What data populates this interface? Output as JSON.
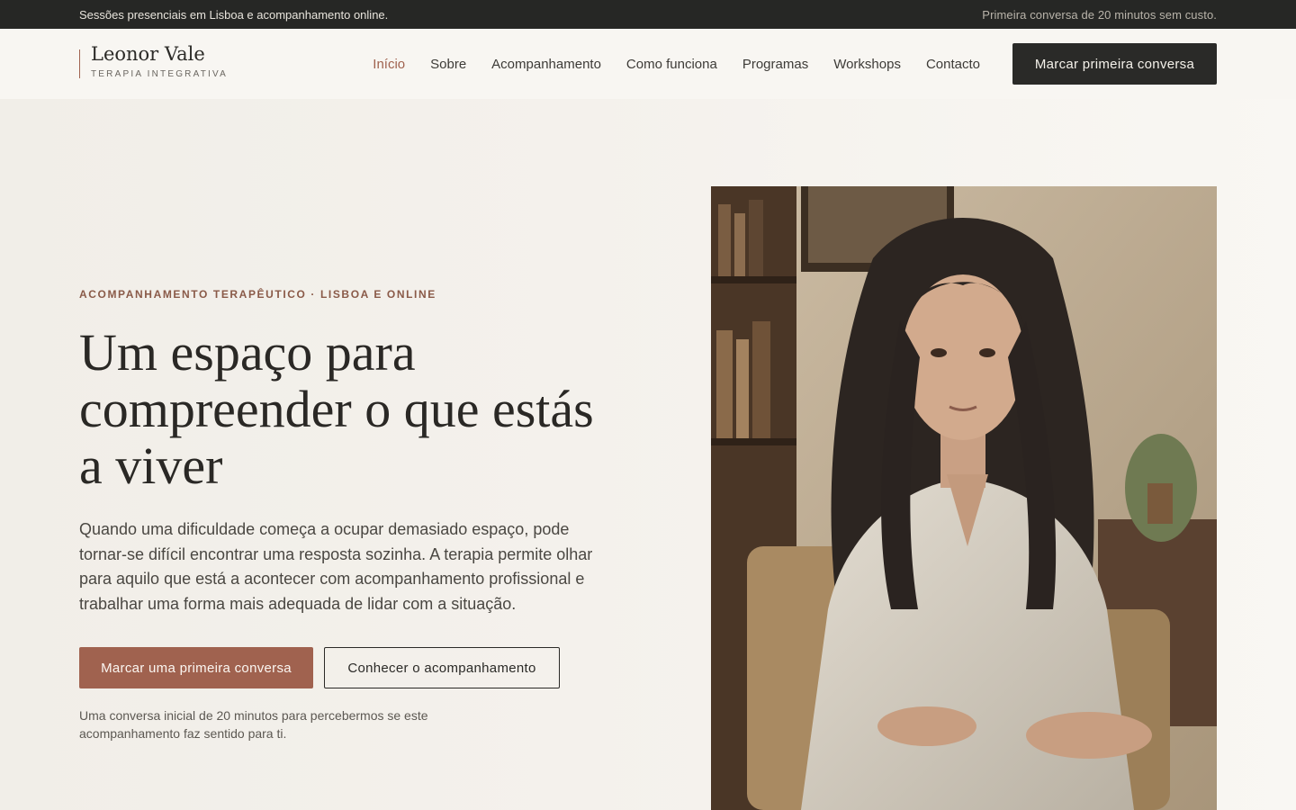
{
  "topbar": {
    "left_text": "Sessões presenciais em Lisboa e acompanhamento online.",
    "right_text": "Primeira conversa de 20 minutos sem custo."
  },
  "brand": {
    "name": "Leonor Vale",
    "tagline": "TERAPIA INTEGRATIVA",
    "accent_color": "#a0624f"
  },
  "nav": {
    "items": [
      {
        "label": "Início",
        "active": true
      },
      {
        "label": "Sobre"
      },
      {
        "label": "Acompanhamento"
      },
      {
        "label": "Como funciona"
      },
      {
        "label": "Programas"
      },
      {
        "label": "Workshops"
      },
      {
        "label": "Contacto"
      }
    ],
    "cta_label": "Marcar primeira conversa"
  },
  "hero": {
    "eyebrow": "ACOMPANHAMENTO TERAPÊUTICO · LISBOA E ONLINE",
    "headline": "Um espaço para compreender o que estás a viver",
    "lead": "Quando uma dificuldade começa a ocupar demasiado espaço, pode tornar-se difícil encontrar uma resposta sozinha. A terapia permite olhar para aquilo que está a acontecer com acompanhamento profissional e trabalhar uma forma mais adequada de lidar com a situação.",
    "primary_button": "Marcar uma primeira conversa",
    "secondary_button": "Conhecer o acompanhamento",
    "note": "Uma conversa inicial de 20 minutos para percebermos se este acompanhamento faz sentido para ti.",
    "photo_subject": "portrait-of-therapist"
  },
  "colors": {
    "topbar_bg": "#262725",
    "page_bg": "#f7f4ef",
    "accent": "#a0624f",
    "dark_button": "#2a2a28"
  }
}
